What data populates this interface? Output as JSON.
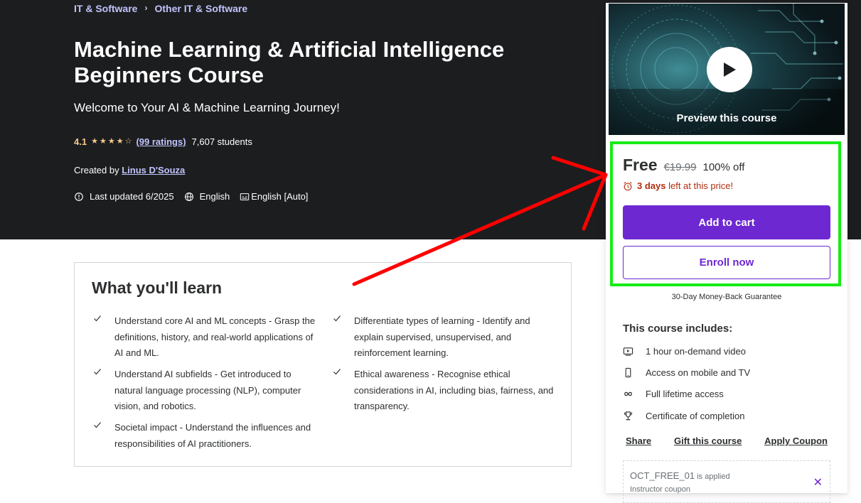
{
  "breadcrumb": {
    "item1": "IT & Software",
    "separator": "›",
    "item2": "Other IT & Software"
  },
  "course": {
    "title": "Machine Learning & Artificial Intelligence Beginners Course",
    "subtitle": "Welcome to Your AI & Machine Learning Journey!",
    "rating": "4.1",
    "stars_value": 4.1,
    "ratings_link": "(99 ratings)",
    "students": "7,607 students",
    "created_by_label": "Created by",
    "instructor": "Linus D'Souza",
    "last_updated": "Last updated 6/2025",
    "language": "English",
    "captions": "English [Auto]"
  },
  "learn": {
    "title": "What you'll learn",
    "items": [
      "Understand core AI and ML concepts - Grasp the definitions, history, and real-world applications of AI and ML.",
      "Differentiate types of learning - Identify and explain supervised, unsupervised, and reinforcement learning.",
      "Understand AI subfields - Get introduced to natural language processing (NLP), computer vision, and robotics.",
      "Ethical awareness - Recognise ethical considerations in AI, including bias, fairness, and transparency.",
      "Societal impact - Understand the influences and responsibilities of AI practitioners."
    ]
  },
  "sidebar": {
    "preview_label": "Preview this course",
    "price": "Free",
    "old_price": "€19.99",
    "discount": "100% off",
    "timer_bold": "3 days",
    "timer_rest": " left at this price!",
    "add_to_cart": "Add to cart",
    "enroll_now": "Enroll now",
    "guarantee": "30-Day Money-Back Guarantee",
    "includes_title": "This course includes:",
    "includes": [
      {
        "icon": "video-icon",
        "label": "1 hour on-demand video"
      },
      {
        "icon": "mobile-icon",
        "label": "Access on mobile and TV"
      },
      {
        "icon": "infinity-icon",
        "label": "Full lifetime access"
      },
      {
        "icon": "trophy-icon",
        "label": "Certificate of completion"
      }
    ],
    "links": {
      "share": "Share",
      "gift": "Gift this course",
      "coupon": "Apply Coupon"
    },
    "coupon": {
      "code": "OCT_FREE_01",
      "applied": " is applied",
      "type": "Instructor coupon"
    }
  },
  "colors": {
    "hero_bg": "#1c1d1f",
    "accent": "#6d28d2",
    "link": "#c0c4fc",
    "star": "#f3ca8c",
    "highlight_box": "#17ec17",
    "arrow": "#ff0000",
    "timer": "#b32d0f"
  }
}
